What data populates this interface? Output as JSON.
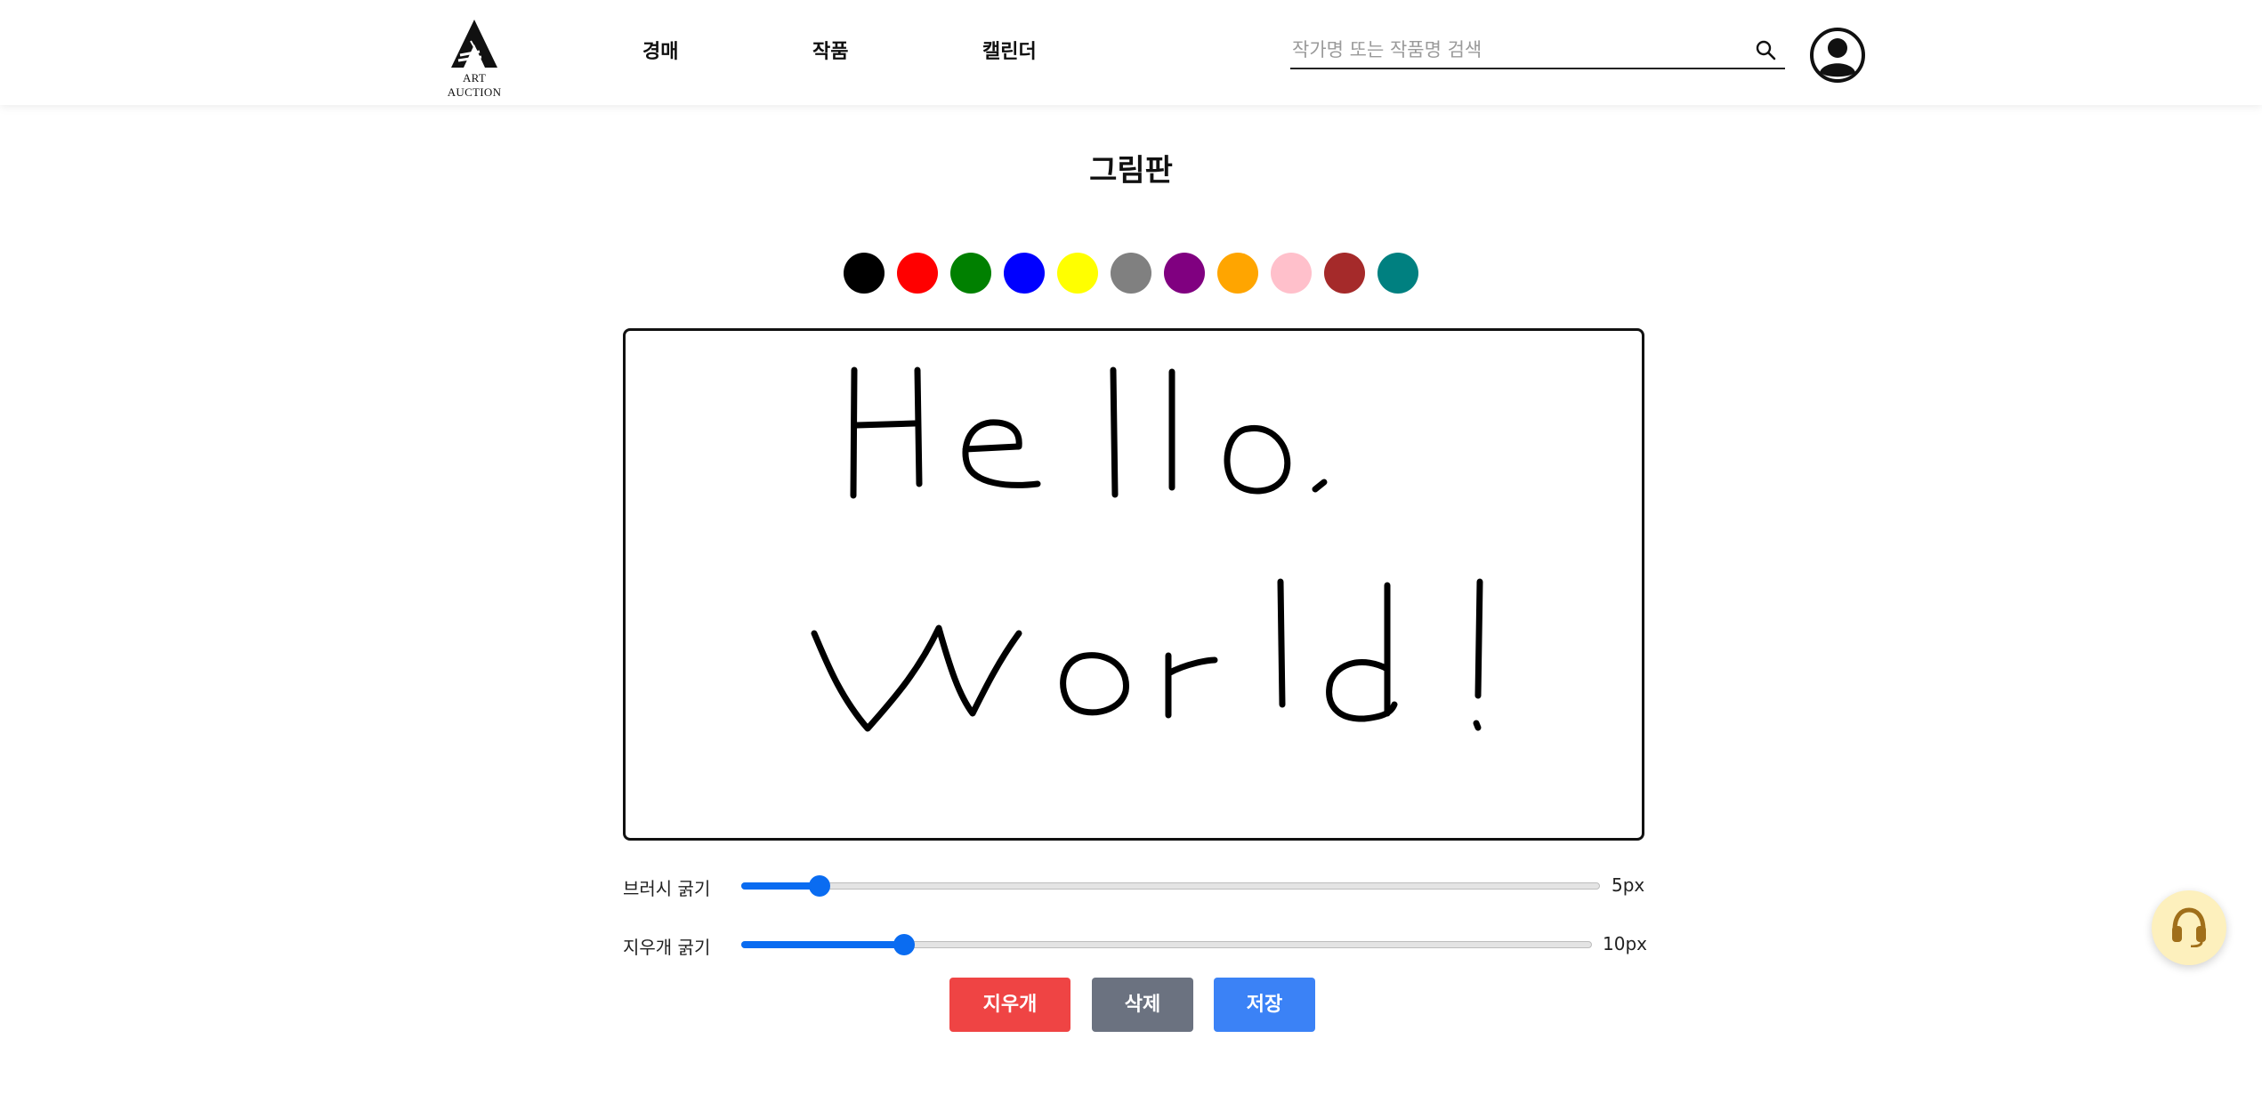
{
  "header": {
    "logo_text": "ART AUCTION",
    "nav": [
      "경매",
      "작품",
      "캘린더"
    ],
    "search_placeholder": "작가명 또는 작품명 검색",
    "search_value": ""
  },
  "page": {
    "title": "그림판"
  },
  "palette": {
    "colors": [
      "#000000",
      "#ff0000",
      "#008000",
      "#0000ff",
      "#ffff00",
      "#808080",
      "#800080",
      "#ffa500",
      "#ffc0cb",
      "#a52a2a",
      "#008080"
    ]
  },
  "canvas": {
    "drawing_text": "Hello. World!"
  },
  "controls": {
    "brush_label": "브러시 굵기",
    "brush_value": "5px",
    "brush_fraction": 0.09,
    "eraser_label": "지우개 굵기",
    "eraser_value": "10px",
    "eraser_fraction": 0.19
  },
  "buttons": {
    "eraser": "지우개",
    "delete": "삭제",
    "save": "저장",
    "eraser_color": "#ef4444",
    "delete_color": "#6b7280",
    "save_color": "#3b82f6"
  },
  "icons": {
    "logo": "art-auction-logo",
    "search": "search-icon",
    "avatar": "user-avatar-icon",
    "support": "headset-icon"
  }
}
